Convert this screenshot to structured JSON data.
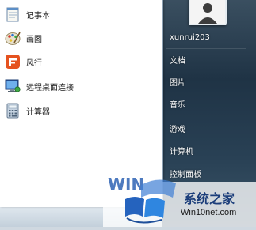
{
  "programs": [
    {
      "label": "记事本",
      "icon": "notepad-icon"
    },
    {
      "label": "画图",
      "icon": "paint-icon"
    },
    {
      "label": "风行",
      "icon": "funshion-icon"
    },
    {
      "label": "远程桌面连接",
      "icon": "remote-desktop-icon"
    },
    {
      "label": "计算器",
      "icon": "calculator-icon"
    }
  ],
  "right_menu": {
    "username": "xunrui203",
    "items": [
      "文档",
      "图片",
      "音乐",
      "游戏",
      "计算机",
      "控制面板"
    ]
  },
  "watermark": {
    "text": "系统之家",
    "url": "Win10net.com"
  },
  "colors": {
    "right_pane": "#1f3345",
    "left_pane": "#ffffff",
    "watermark_blue": "#1b3d7a"
  }
}
